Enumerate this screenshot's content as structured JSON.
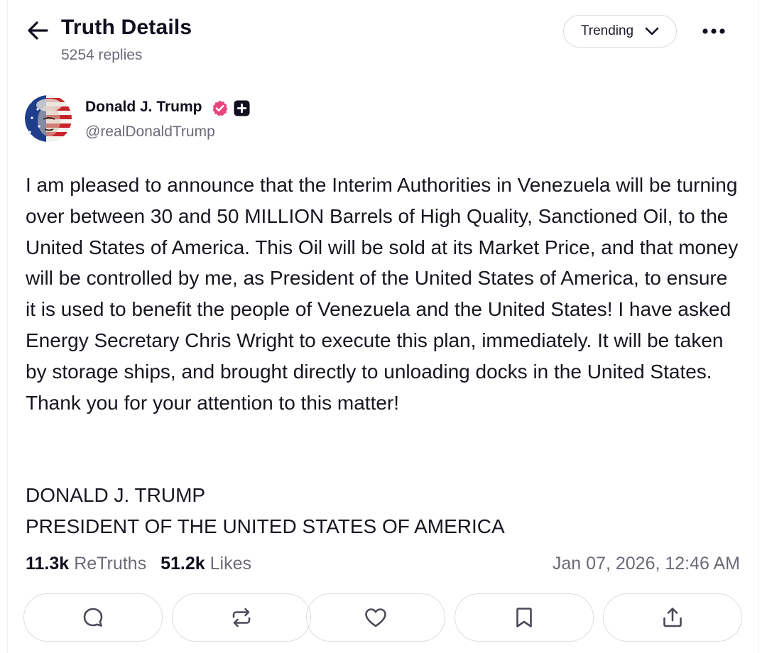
{
  "header": {
    "title": "Truth Details",
    "reply_count": "5254 replies",
    "sort": {
      "selected": "Trending"
    },
    "icons": {
      "back": "arrow-left-icon",
      "sort_chevron": "chevron-down-icon",
      "more": "more-horizontal-icon"
    }
  },
  "post": {
    "author": {
      "name": "Donald J. Trump",
      "handle": "@realDonaldTrump",
      "verified_color": "#e8457b"
    },
    "body": "I am pleased to announce that the Interim Authorities in Venezuela will be turning over between 30 and 50 MILLION Barrels of High Quality, Sanctioned Oil, to the United States of America. This Oil will be sold at its Market Price, and that money will be controlled by me, as President of the United States of America, to ensure it is used to benefit the people of Venezuela and the United States! I have asked Energy Secretary Chris Wright to execute this plan, immediately. It will be taken by storage ships, and brought directly to unloading docks in the United States. Thank you for your attention to this matter!",
    "signature": {
      "line1": "DONALD J. TRUMP",
      "line2": "PRESIDENT OF THE UNITED STATES OF AMERICA"
    },
    "stats": {
      "retruths_count": "11.3k",
      "retruths_label": "ReTruths",
      "likes_count": "51.2k",
      "likes_label": "Likes"
    },
    "timestamp": "Jan 07, 2026, 12:46 AM"
  },
  "actions": [
    {
      "icon": "reply-icon"
    },
    {
      "icon": "retruth-icon"
    },
    {
      "icon": "like-icon"
    },
    {
      "icon": "bookmark-icon"
    },
    {
      "icon": "share-icon"
    }
  ],
  "colors": {
    "text_primary": "#0f0f1f",
    "text_secondary": "#6b6b78",
    "border": "#dcdce2",
    "verified": "#e8457b"
  }
}
